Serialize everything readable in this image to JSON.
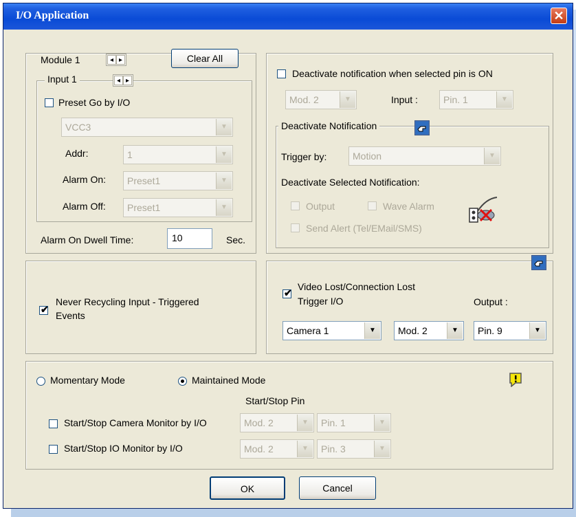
{
  "window": {
    "title": "I/O Application",
    "close_glyph": "✕"
  },
  "module_group": {
    "module_label": "Module 1",
    "clear_all": "Clear All",
    "input_label": "Input 1",
    "preset_go": "Preset Go by I/O",
    "vcc_value": "VCC3",
    "addr_label": "Addr:",
    "addr_value": "1",
    "alarm_on_label": "Alarm On:",
    "alarm_on_value": "Preset1",
    "alarm_off_label": "Alarm Off:",
    "alarm_off_value": "Preset1",
    "dwell_label": "Alarm On Dwell Time:",
    "dwell_value": "10",
    "dwell_unit": "Sec."
  },
  "deactivate_group": {
    "checkbox_label": "Deactivate notification when selected pin is ON",
    "mod_value": "Mod. 2",
    "input_label": "Input :",
    "pin_value": "Pin. 1",
    "sub_legend": "Deactivate Notification",
    "trigger_label": "Trigger by:",
    "trigger_value": "Motion",
    "selected_label": "Deactivate Selected Notification:",
    "output": "Output",
    "wave_alarm": "Wave Alarm",
    "send_alert": "Send Alert (Tel/EMail/SMS)"
  },
  "recycle_group": {
    "label_line1": "Never Recycling Input - Triggered",
    "label_line2": "Events"
  },
  "video_lost_group": {
    "label_line1": "Video Lost/Connection Lost",
    "label_line2": "Trigger I/O",
    "output_label": "Output :",
    "camera_value": "Camera 1",
    "mod_value": "Mod. 2",
    "pin_value": "Pin. 9"
  },
  "mode_group": {
    "momentary": "Momentary Mode",
    "maintained": "Maintained Mode",
    "start_stop_pin": "Start/Stop Pin",
    "camera_monitor": "Start/Stop Camera Monitor by I/O",
    "camera_mod": "Mod. 2",
    "camera_pin": "Pin. 1",
    "io_monitor": "Start/Stop IO Monitor by I/O",
    "io_mod": "Mod. 2",
    "io_pin": "Pin. 3"
  },
  "buttons": {
    "ok": "OK",
    "cancel": "Cancel"
  },
  "icons": {
    "close": "close-icon",
    "hand": "pointing-hand-icon",
    "warning": "warning-icon",
    "no_alarm": "alarm-off-icon"
  },
  "colors": {
    "titlebar": "#0a4bd6",
    "dialog_bg": "#ece9d8",
    "warning": "#f5e60a"
  }
}
